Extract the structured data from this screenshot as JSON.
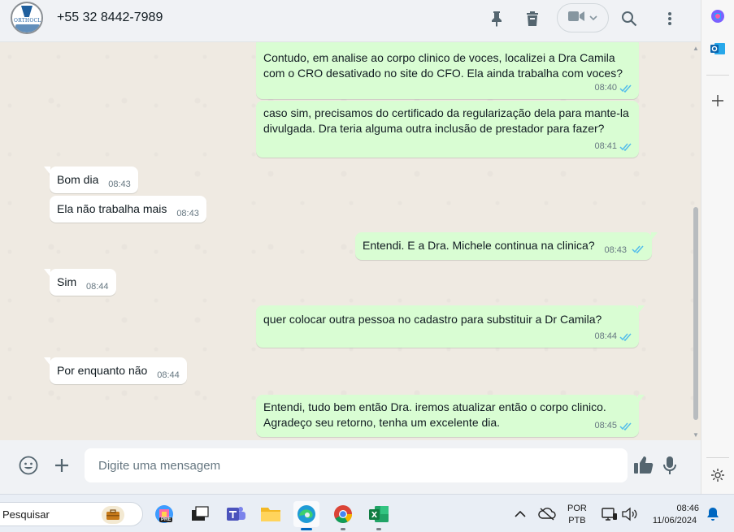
{
  "header": {
    "contact_name": "+55 32 8442-7989",
    "avatar_logo_text": "ORTHOCLIN"
  },
  "messages": [
    {
      "dir": "out",
      "text": "Contudo, em analise ao corpo clinico de voces, localizei a Dra Camila com o CRO desativado no site do CFO. Ela ainda trabalha com voces?",
      "time": "08:40",
      "status": "read"
    },
    {
      "dir": "out",
      "text": "caso sim, precisamos do certificado da regularização dela para mante-la divulgada. Dra teria alguma outra inclusão de prestador para fazer?",
      "time": "08:41",
      "status": "read"
    },
    {
      "dir": "in",
      "text": "Bom dia",
      "time": "08:43"
    },
    {
      "dir": "in",
      "text": "Ela não trabalha mais",
      "time": "08:43"
    },
    {
      "dir": "out",
      "text": "Entendi. E a Dra. Michele continua na clinica?",
      "time": "08:43",
      "status": "read"
    },
    {
      "dir": "in",
      "text": "Sim",
      "time": "08:44"
    },
    {
      "dir": "out",
      "text": "quer colocar outra pessoa no cadastro para substituir a Dr Camila?",
      "time": "08:44",
      "status": "read"
    },
    {
      "dir": "in",
      "text": "Por enquanto não",
      "time": "08:44"
    },
    {
      "dir": "out",
      "text": "Entendi, tudo bem então Dra. iremos atualizar então o corpo clinico. Agradeço seu retorno, tenha um excelente dia.",
      "time": "08:45",
      "status": "read"
    }
  ],
  "composer": {
    "placeholder": "Digite uma mensagem"
  },
  "taskbar": {
    "search_placeholder": "Pesquisar",
    "copilot_badge": "PRE",
    "language_line1": "POR",
    "language_line2": "PTB",
    "clock_time": "08:46",
    "clock_date": "11/06/2024"
  },
  "colors": {
    "outgoing_bubble": "#d9fdd3",
    "incoming_bubble": "#ffffff",
    "chat_background": "#efeae2",
    "read_ticks": "#53bdeb"
  }
}
